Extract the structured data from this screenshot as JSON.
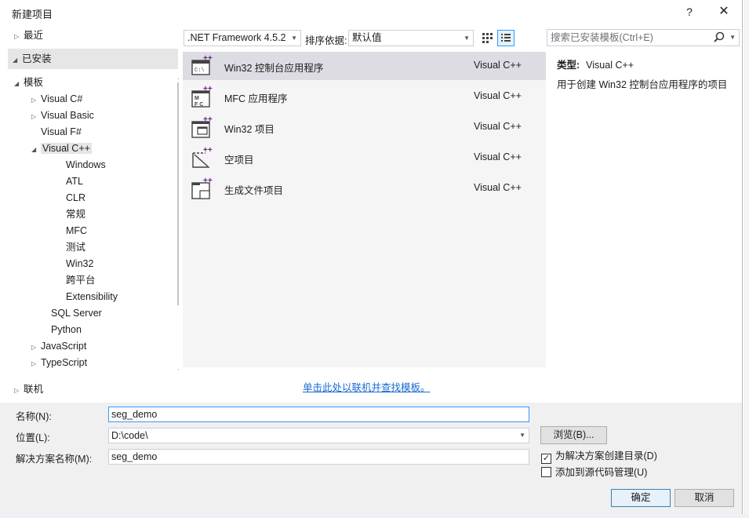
{
  "window": {
    "title": "新建项目",
    "help_label": "?",
    "close_label": "✕"
  },
  "tree": {
    "recent": "最近",
    "installed": "已安装",
    "templates": "模板",
    "nodes": [
      {
        "label": "Visual C#",
        "expander": "▷"
      },
      {
        "label": "Visual Basic",
        "expander": "▷"
      },
      {
        "label": "Visual F#",
        "expander": ""
      },
      {
        "label": "Visual C++",
        "expander": "◢"
      },
      {
        "label": "Windows",
        "expander": ""
      },
      {
        "label": "ATL",
        "expander": ""
      },
      {
        "label": "CLR",
        "expander": ""
      },
      {
        "label": "常规",
        "expander": ""
      },
      {
        "label": "MFC",
        "expander": ""
      },
      {
        "label": "测试",
        "expander": ""
      },
      {
        "label": "Win32",
        "expander": ""
      },
      {
        "label": "跨平台",
        "expander": ""
      },
      {
        "label": "Extensibility",
        "expander": ""
      },
      {
        "label": "SQL Server",
        "expander": ""
      },
      {
        "label": "Python",
        "expander": ""
      },
      {
        "label": "JavaScript",
        "expander": "▷"
      },
      {
        "label": "TypeScript",
        "expander": "▷"
      }
    ],
    "online": "联机"
  },
  "toolbar": {
    "framework": ".NET Framework 4.5.2",
    "sort_label": "排序依据:",
    "sort_value": "默认值",
    "search_placeholder": "搜索已安装模板(Ctrl+E)"
  },
  "templates": [
    {
      "name": "Win32 控制台应用程序",
      "lang": "Visual C++",
      "icon": "console-app-icon",
      "selected": true
    },
    {
      "name": "MFC 应用程序",
      "lang": "Visual C++",
      "icon": "mfc-app-icon",
      "selected": false
    },
    {
      "name": "Win32 项目",
      "lang": "Visual C++",
      "icon": "win32-project-icon",
      "selected": false
    },
    {
      "name": "空项目",
      "lang": "Visual C++",
      "icon": "empty-project-icon",
      "selected": false
    },
    {
      "name": "生成文件项目",
      "lang": "Visual C++",
      "icon": "makefile-project-icon",
      "selected": false
    }
  ],
  "online_link": "单击此处以联机并查找模板。",
  "description": {
    "type_label": "类型:",
    "type_value": "Visual C++",
    "text": "用于创建 Win32 控制台应用程序的项目"
  },
  "form": {
    "name_label": "名称(N):",
    "name_value": "seg_demo",
    "location_label": "位置(L):",
    "location_value": "D:\\code\\",
    "solution_label": "解决方案名称(M):",
    "solution_value": "seg_demo",
    "browse_label": "浏览(B)...",
    "create_dir_label": "为解决方案创建目录(D)",
    "create_dir_checked": true,
    "source_control_label": "添加到源代码管理(U)",
    "source_control_checked": false,
    "ok_label": "确定",
    "cancel_label": "取消"
  },
  "colors": {
    "accent": "#3399ff",
    "link": "#1a6bd1",
    "selection": "#dcdce2",
    "icon_purple": "#68217a"
  }
}
